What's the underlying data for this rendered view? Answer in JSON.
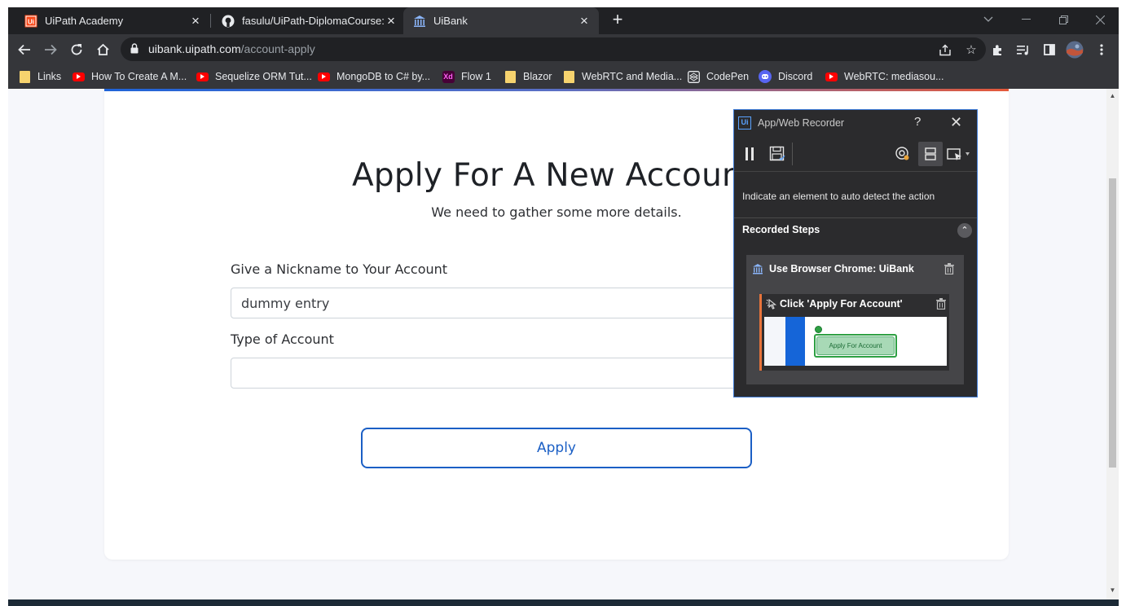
{
  "browser": {
    "tabs": [
      {
        "title": "UiPath Academy",
        "favicon": "uipath-icon",
        "active": false
      },
      {
        "title": "fasulu/UiPath-DiplomaCourse: Re",
        "favicon": "github-icon",
        "active": false
      },
      {
        "title": "UiBank",
        "favicon": "bank-icon",
        "active": true
      }
    ],
    "url_host": "uibank.uipath.com",
    "url_path": "/account-apply",
    "bookmarks": [
      {
        "label": "Links",
        "icon": "folder-icon"
      },
      {
        "label": "How To Create A M...",
        "icon": "youtube-icon"
      },
      {
        "label": "Sequelize ORM Tut...",
        "icon": "youtube-icon"
      },
      {
        "label": "MongoDB to C# by...",
        "icon": "youtube-icon"
      },
      {
        "label": "Flow 1",
        "icon": "xd-icon"
      },
      {
        "label": "Blazor",
        "icon": "folder-icon"
      },
      {
        "label": "WebRTC and Media...",
        "icon": "folder-icon"
      },
      {
        "label": "CodePen",
        "icon": "codepen-icon"
      },
      {
        "label": "Discord",
        "icon": "discord-icon"
      },
      {
        "label": "WebRTC: mediasou...",
        "icon": "youtube-icon"
      }
    ]
  },
  "page": {
    "heading": "Apply For A New Accoun",
    "subheading": "We need to gather some more details.",
    "nickname_label": "Give a Nickname to Your Account",
    "nickname_value": "dummy entry",
    "type_label": "Type of Account",
    "type_value": "",
    "apply_label": "Apply"
  },
  "recorder": {
    "title": "App/Web Recorder",
    "help": "?",
    "hint": "Indicate an element to auto detect the action",
    "steps_header": "Recorded Steps",
    "outer_step": "Use Browser Chrome: UiBank",
    "inner_step": "Click 'Apply For Account'",
    "thumb_button": "Apply For Account"
  },
  "colors": {
    "accent_blue": "#1b5fc5",
    "recorder_border": "#3e7bd6",
    "step_accent": "#e8743b"
  }
}
